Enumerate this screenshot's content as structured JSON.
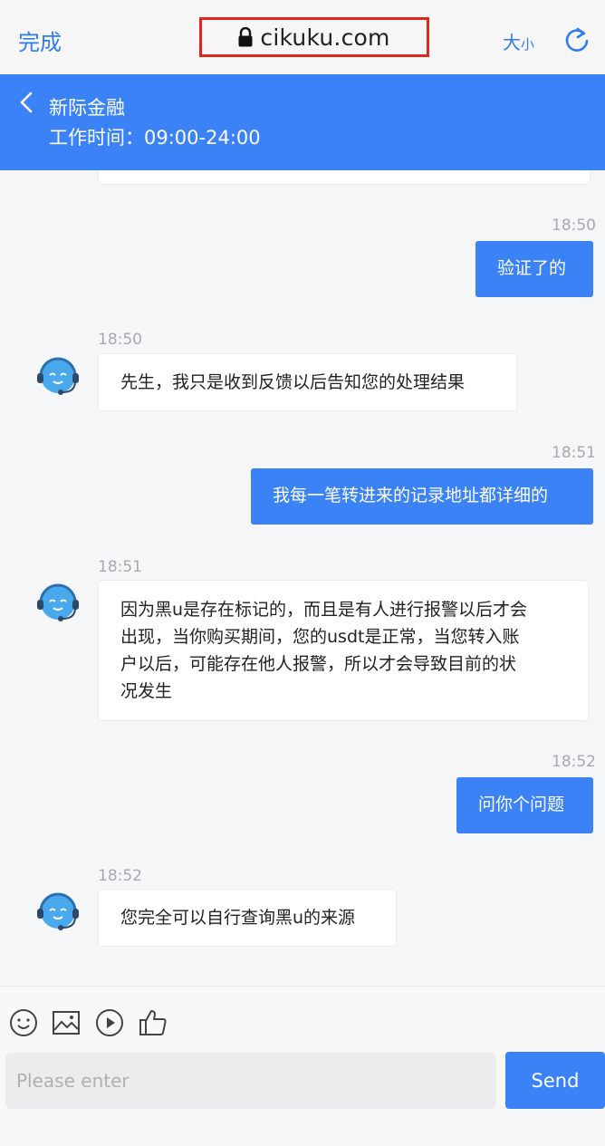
{
  "browser": {
    "done_label": "完成",
    "url": "cikuku.com",
    "size_big": "大",
    "size_small": "小",
    "icons": [
      "lock-icon",
      "refresh-icon"
    ]
  },
  "header": {
    "title": "新际金融",
    "hours": "工作时间：09:00-24:00",
    "background": "#3b82f6"
  },
  "messages": [
    {
      "side": "out",
      "time": "18:50",
      "text": "验证了的"
    },
    {
      "side": "in",
      "time": "18:50",
      "text": "先生，我只是收到反馈以后告知您的处理结果"
    },
    {
      "side": "out",
      "time": "18:51",
      "text": "我每一笔转进来的记录地址都详细的"
    },
    {
      "side": "in",
      "time": "18:51",
      "lines": [
        "因为黑u是存在标记的，而且是有人进行报警以后才会",
        "出现，当你购买期间，您的usdt是正常，当您转入账",
        "户以后，可能存在他人报警，所以才会导致目前的状",
        "况发生"
      ]
    },
    {
      "side": "out",
      "time": "18:52",
      "text": "问你个问题"
    },
    {
      "side": "in",
      "time": "18:52",
      "text": "您完全可以自行查询黑u的来源"
    }
  ],
  "composer": {
    "tools": [
      "emoji-icon",
      "image-icon",
      "video-icon",
      "thumbs-up-icon"
    ],
    "placeholder": "Please enter",
    "send_label": "Send"
  }
}
